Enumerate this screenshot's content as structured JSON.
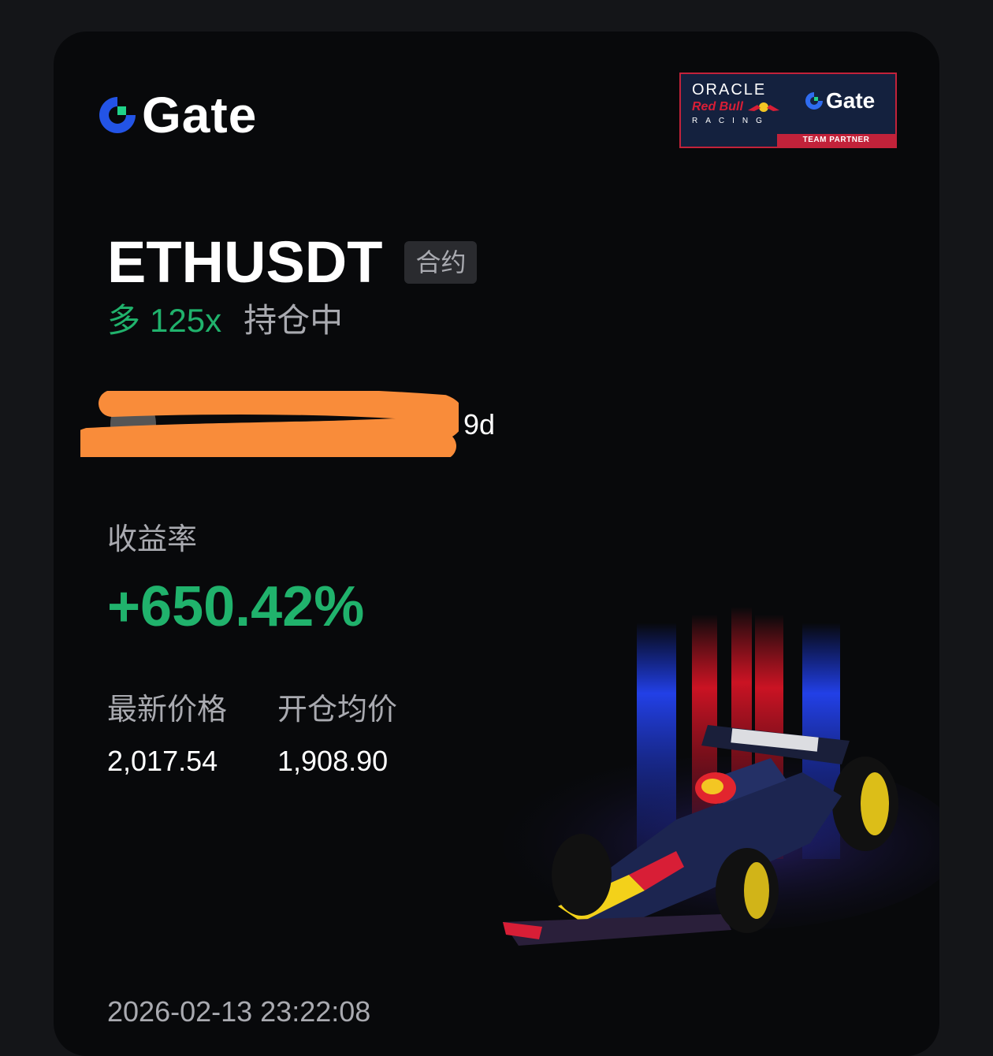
{
  "brand": {
    "logo_text": "Gate",
    "accent_color": "#2354e6"
  },
  "partner_badge": {
    "oracle": "ORACLE",
    "redbull": "Red Bull",
    "racing": "RACING",
    "gate": "Gate",
    "strip": "TEAM PARTNER"
  },
  "position": {
    "pair": "ETHUSDT",
    "contract_tag": "合约",
    "side": "多",
    "leverage": "125x",
    "status": "持仓中"
  },
  "user": {
    "name_visible_suffix": "9d"
  },
  "yield": {
    "label": "收益率",
    "value": "+650.42%"
  },
  "prices": {
    "last_label": "最新价格",
    "last_value": "2,017.54",
    "entry_label": "开仓均价",
    "entry_value": "1,908.90"
  },
  "timestamp": "2026-02-13 23:22:08",
  "colors": {
    "profit_green": "#20b26c",
    "muted_text": "#a9aab0",
    "card_bg": "#08090b",
    "page_bg": "#141518",
    "redact_orange": "#f98c3a"
  }
}
